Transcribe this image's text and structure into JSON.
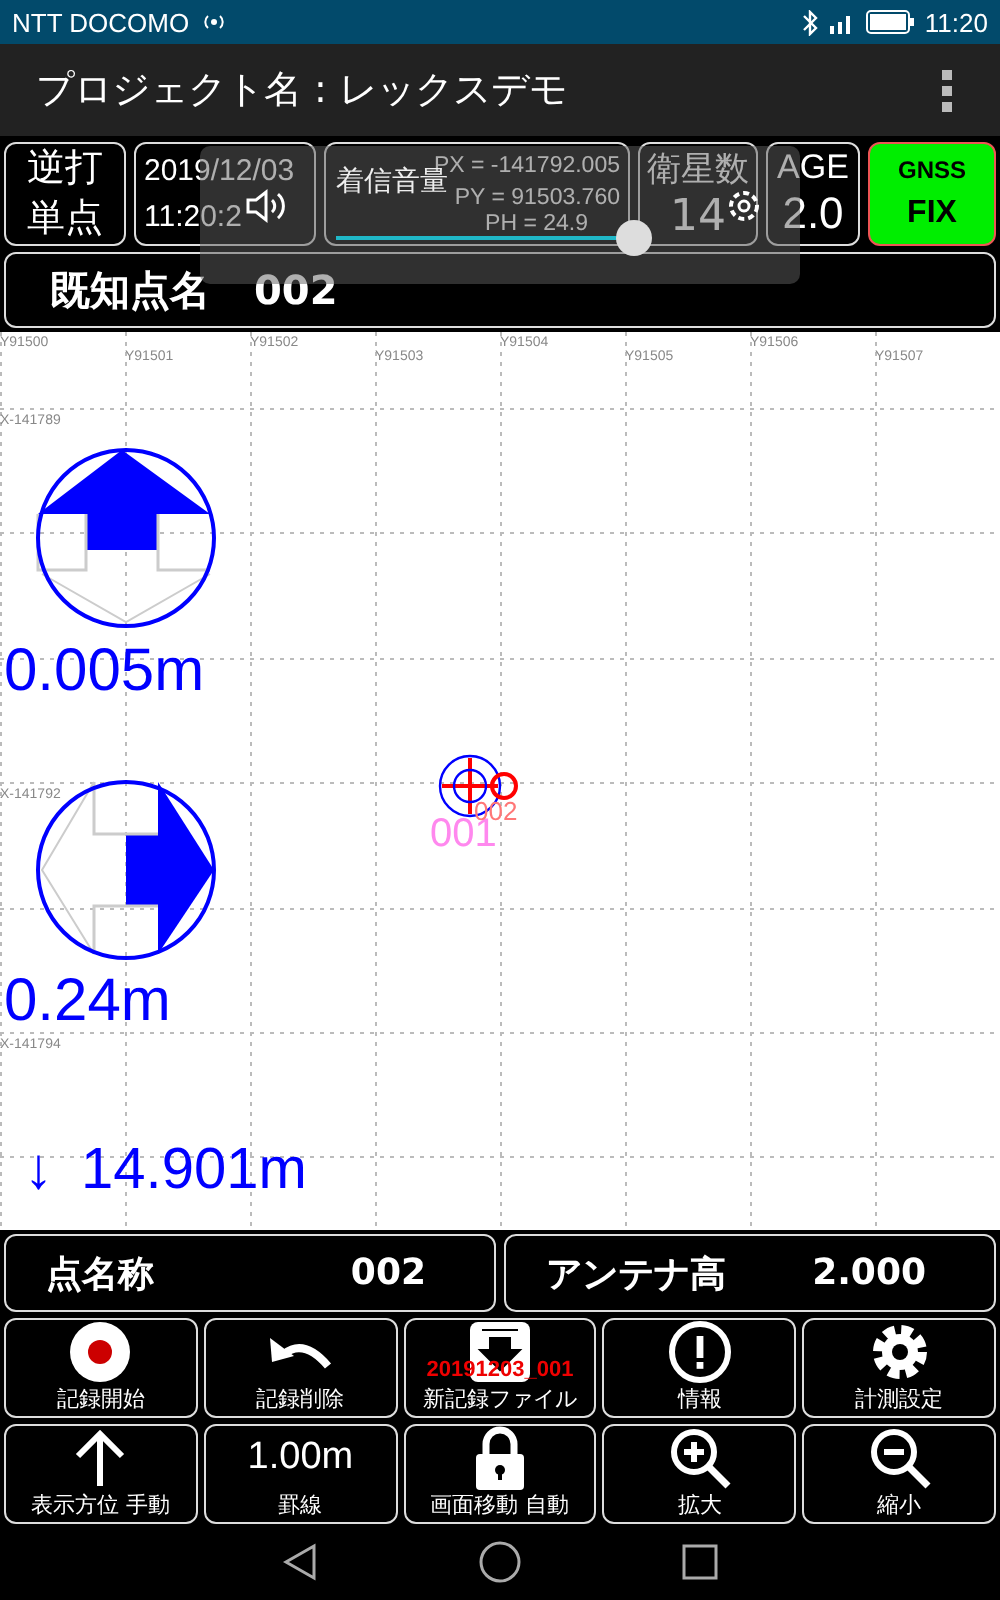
{
  "status_bar": {
    "carrier": "NTT DOCOMO",
    "time": "11:20"
  },
  "app_bar": {
    "title": "プロジェクト名 : レックスデモ"
  },
  "info": {
    "mode": [
      "逆打",
      "単点"
    ],
    "date": "2019/12/03",
    "time": "11:20:2",
    "coords": [
      "PX = -141792.005",
      "PY = 91503.760",
      "PH = 24.9"
    ],
    "satellites_label": "衛星数",
    "satellites": "14",
    "age_label": "AGE",
    "age": "2.0",
    "gnss_label": "GNSS",
    "gnss_status": "FIX",
    "fix": true
  },
  "volume_popup": {
    "label": "着信音量",
    "level": 0.82
  },
  "known_point": {
    "label": "既知点名",
    "value": "002"
  },
  "map": {
    "y_labels": [
      "Y91500",
      "Y91501",
      "Y91502",
      "Y91503",
      "Y91504",
      "Y91505",
      "Y91506",
      "Y91507"
    ],
    "x_labels": [
      "X-141789",
      "X-141792",
      "X-141794"
    ],
    "north_offset": "0.005m",
    "east_offset": "0.24m",
    "height_arrow": "↓",
    "height_offset": "14.901m",
    "points": [
      {
        "label": "001",
        "color": "#ff88ee"
      },
      {
        "label": "002",
        "color": "#ff7777"
      }
    ]
  },
  "point_row": {
    "name_label": "点名称",
    "name": "002",
    "antenna_label": "アンテナ高",
    "antenna": "2.000"
  },
  "buttons": [
    {
      "kind": "record",
      "label": "記録開始"
    },
    {
      "kind": "undo",
      "label": "記録削除"
    },
    {
      "kind": "file",
      "label": "新記録ファイル",
      "badge": "20191203_001"
    },
    {
      "kind": "info",
      "label": "情報"
    },
    {
      "kind": "gear",
      "label": "計測設定"
    },
    {
      "kind": "arrow",
      "label": "表示方位 手動"
    },
    {
      "kind": "text",
      "label": "罫線",
      "value": "1.00m"
    },
    {
      "kind": "lock",
      "label": "画面移動 自動"
    },
    {
      "kind": "zoomin",
      "label": "拡大"
    },
    {
      "kind": "zoomout",
      "label": "縮小"
    }
  ]
}
